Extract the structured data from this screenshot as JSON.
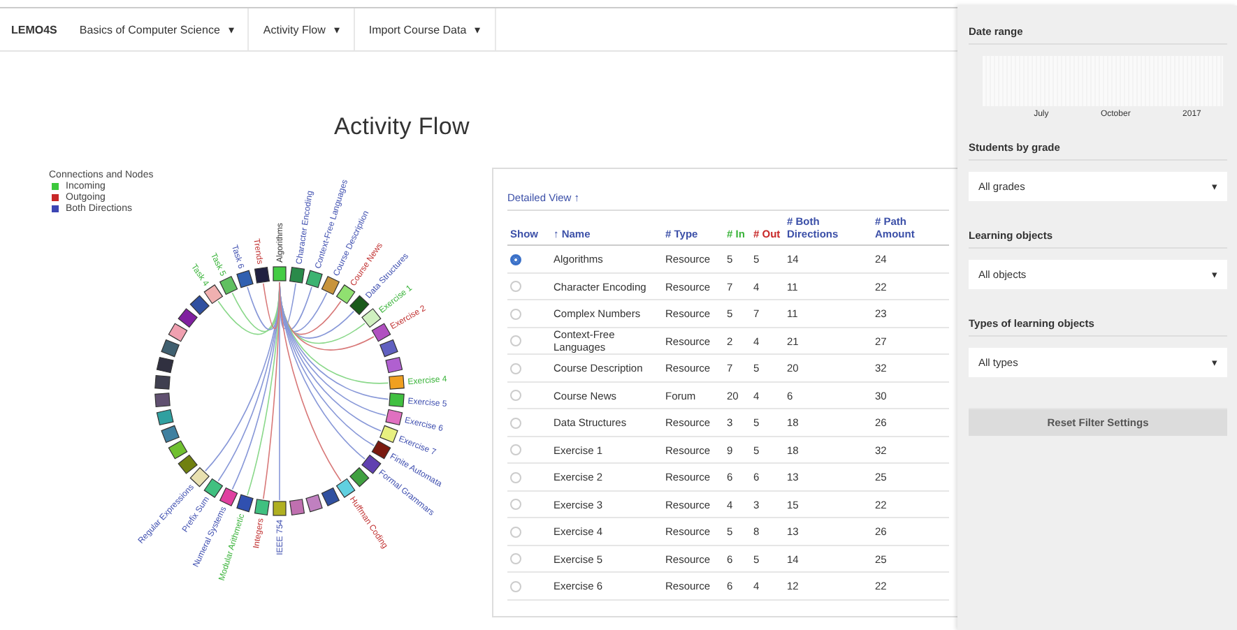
{
  "nav": {
    "brand": "LEMO4S",
    "menus": [
      {
        "label": "Basics of Computer Science",
        "caret": "▾"
      },
      {
        "label": "Activity Flow",
        "caret": "▾"
      },
      {
        "label": "Import Course Data",
        "caret": "▾"
      }
    ]
  },
  "title": "Activity Flow",
  "legend": {
    "title": "Connections and Nodes",
    "items": [
      {
        "label": "Incoming",
        "color": "#3cc83c"
      },
      {
        "label": "Outgoing",
        "color": "#c82828"
      },
      {
        "label": "Both Directions",
        "color": "#3c46b4"
      }
    ]
  },
  "diagram": {
    "nodes": [
      {
        "label": "Algorithms",
        "kind": "source",
        "color": "#44cc44"
      },
      {
        "label": "Character Encoding",
        "kind": "both",
        "color": "#2a8a4a"
      },
      {
        "label": "Context-Free Languages",
        "kind": "both",
        "color": "#3cb371"
      },
      {
        "label": "Course Description",
        "kind": "both",
        "color": "#c8943c"
      },
      {
        "label": "Course News",
        "kind": "outgoing",
        "color": "#90e070"
      },
      {
        "label": "Data Structures",
        "kind": "both",
        "color": "#1a5a1a"
      },
      {
        "label": "Exercise 1",
        "kind": "incoming",
        "color": "#d0f0c0"
      },
      {
        "label": "Exercise 2",
        "kind": "outgoing",
        "color": "#b050c0"
      },
      {
        "kind": "none",
        "color": "#6060c0"
      },
      {
        "kind": "none",
        "color": "#b060d0"
      },
      {
        "label": "Exercise 4",
        "kind": "incoming",
        "color": "#f0a020"
      },
      {
        "label": "Exercise 5",
        "kind": "both",
        "color": "#40c040"
      },
      {
        "label": "Exercise 6",
        "kind": "both",
        "color": "#e070c0"
      },
      {
        "label": "Exercise 7",
        "kind": "both",
        "color": "#e8f080"
      },
      {
        "label": "Finite Automata",
        "kind": "both",
        "color": "#7a1a10"
      },
      {
        "label": "Formal Grammars",
        "kind": "both",
        "color": "#6040b0"
      },
      {
        "kind": "none",
        "color": "#40a040"
      },
      {
        "label": "Huffman Coding",
        "kind": "outgoing",
        "color": "#60d0e0"
      },
      {
        "kind": "none",
        "color": "#3050a0"
      },
      {
        "kind": "none",
        "color": "#c080c0"
      },
      {
        "kind": "none",
        "color": "#c070b0"
      },
      {
        "label": "IEEE 754",
        "kind": "both",
        "color": "#b0b020"
      },
      {
        "label": "Integers",
        "kind": "outgoing",
        "color": "#40c080"
      },
      {
        "label": "Modular Arithmetic",
        "kind": "incoming",
        "color": "#3050b0"
      },
      {
        "label": "Numeral Systems",
        "kind": "both",
        "color": "#e040a0"
      },
      {
        "label": "Prefix Sum",
        "kind": "both",
        "color": "#40c080"
      },
      {
        "label": "Regular Expressions",
        "kind": "both",
        "color": "#e8e0b0"
      },
      {
        "kind": "none",
        "color": "#708010"
      },
      {
        "kind": "none",
        "color": "#70c030"
      },
      {
        "kind": "none",
        "color": "#4080a0"
      },
      {
        "kind": "none",
        "color": "#30a0a0"
      },
      {
        "kind": "none",
        "color": "#605070"
      },
      {
        "kind": "none",
        "color": "#404050"
      },
      {
        "kind": "none",
        "color": "#303040"
      },
      {
        "kind": "none",
        "color": "#406070"
      },
      {
        "kind": "none",
        "color": "#f0a0b0"
      },
      {
        "kind": "none",
        "color": "#8020a0"
      },
      {
        "kind": "none",
        "color": "#3050a0"
      },
      {
        "label": "Task 4",
        "kind": "incoming",
        "color": "#f0b0b0"
      },
      {
        "label": "Task 5",
        "kind": "incoming",
        "color": "#60c060"
      },
      {
        "label": "Task 6",
        "kind": "both",
        "color": "#3060b0"
      },
      {
        "label": "Trends",
        "kind": "outgoing",
        "color": "#202040"
      }
    ]
  },
  "table": {
    "link": "Detailed View ↑",
    "columns": [
      {
        "label": "Show"
      },
      {
        "label": "Name",
        "mark": "↑"
      },
      {
        "label": "Type",
        "mark": "#"
      },
      {
        "label": "In",
        "mark": "#",
        "color": "#3cb43c"
      },
      {
        "label": "Out",
        "mark": "#",
        "color": "#c82828"
      },
      {
        "label": "Both Directions",
        "mark": "#"
      },
      {
        "label": "Path Amount",
        "mark": "#"
      }
    ],
    "rows": [
      {
        "selected": true,
        "cells": [
          "",
          "Algorithms",
          "Resource",
          "5",
          "5",
          "14",
          "24"
        ]
      },
      {
        "selected": false,
        "cells": [
          "",
          "Character Encoding",
          "Resource",
          "7",
          "4",
          "11",
          "22"
        ]
      },
      {
        "selected": false,
        "cells": [
          "",
          "Complex Numbers",
          "Resource",
          "5",
          "7",
          "11",
          "23"
        ]
      },
      {
        "selected": false,
        "cells": [
          "",
          "Context-Free Languages",
          "Resource",
          "2",
          "4",
          "21",
          "27"
        ]
      },
      {
        "selected": false,
        "cells": [
          "",
          "Course Description",
          "Resource",
          "7",
          "5",
          "20",
          "32"
        ]
      },
      {
        "selected": false,
        "cells": [
          "",
          "Course News",
          "Forum",
          "20",
          "4",
          "6",
          "30"
        ]
      },
      {
        "selected": false,
        "cells": [
          "",
          "Data Structures",
          "Resource",
          "3",
          "5",
          "18",
          "26"
        ]
      },
      {
        "selected": false,
        "cells": [
          "",
          "Exercise 1",
          "Resource",
          "9",
          "5",
          "18",
          "32"
        ]
      },
      {
        "selected": false,
        "cells": [
          "",
          "Exercise 2",
          "Resource",
          "6",
          "6",
          "13",
          "25"
        ]
      },
      {
        "selected": false,
        "cells": [
          "",
          "Exercise 3",
          "Resource",
          "4",
          "3",
          "15",
          "22"
        ]
      },
      {
        "selected": false,
        "cells": [
          "",
          "Exercise 4",
          "Resource",
          "5",
          "8",
          "13",
          "26"
        ]
      },
      {
        "selected": false,
        "cells": [
          "",
          "Exercise 5",
          "Resource",
          "6",
          "5",
          "14",
          "25"
        ]
      },
      {
        "selected": false,
        "cells": [
          "",
          "Exercise 6",
          "Resource",
          "6",
          "4",
          "12",
          "22"
        ]
      }
    ]
  },
  "filters": {
    "date_range": {
      "label": "Date range",
      "ticks": [
        "July",
        "October",
        "2017"
      ]
    },
    "selects": [
      {
        "label": "Students by grade",
        "value": "All grades",
        "caret": "▾"
      },
      {
        "label": "Learning objects",
        "value": "All objects",
        "caret": "▾"
      },
      {
        "label": "Types of learning objects",
        "value": "All types",
        "caret": "▾"
      }
    ],
    "reset": "Reset Filter Settings"
  }
}
